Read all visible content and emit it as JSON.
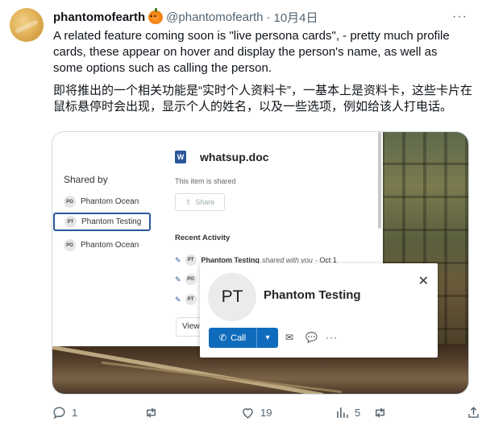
{
  "author": {
    "display_name": "phantomofearth",
    "handle": "@phantomofearth",
    "dot": "·",
    "date": "10月4日"
  },
  "tweet": {
    "text_en": "A related feature coming soon is \"live persona cards\", - pretty much profile cards, these appear on hover and display the person's name, as well as some options such as calling the person.",
    "text_zh": "即将推出的一个相关功能是“实时个人资料卡”，一基本上是资料卡，这些卡片在鼠标悬停时会出现，显示个人的姓名，以及一些选项，例如给该人打电话。"
  },
  "screenshot": {
    "doc_title": "whatsup.doc",
    "word_badge": "W",
    "shared_note": "This item is shared",
    "share_label": "Share",
    "shared_by_label": "Shared by",
    "shared_by": [
      {
        "initials": "PO",
        "name": "Phantom Ocean"
      },
      {
        "initials": "PT",
        "name": "Phantom Testing"
      },
      {
        "initials": "PO",
        "name": "Phantom Ocean"
      }
    ],
    "recent_activity_label": "Recent Activity",
    "activity": [
      {
        "initials": "PT",
        "name": "Phantom Testing",
        "action": "shared with you",
        "time": "· Oct 1"
      },
      {
        "initials": "PO",
        "name": "",
        "action": "",
        "time": ""
      },
      {
        "initials": "PT",
        "name": "",
        "action": "",
        "time": ""
      }
    ],
    "view_label": "View",
    "card": {
      "initials": "PT",
      "name": "Phantom Testing",
      "call_label": "Call"
    }
  },
  "actions": {
    "replies": "1",
    "reposts": "",
    "likes": "19",
    "views": "5",
    "icons": [
      "reply-icon",
      "retweet-icon",
      "like-icon",
      "views-icon",
      "bookmark-icon",
      "share-icon"
    ]
  }
}
